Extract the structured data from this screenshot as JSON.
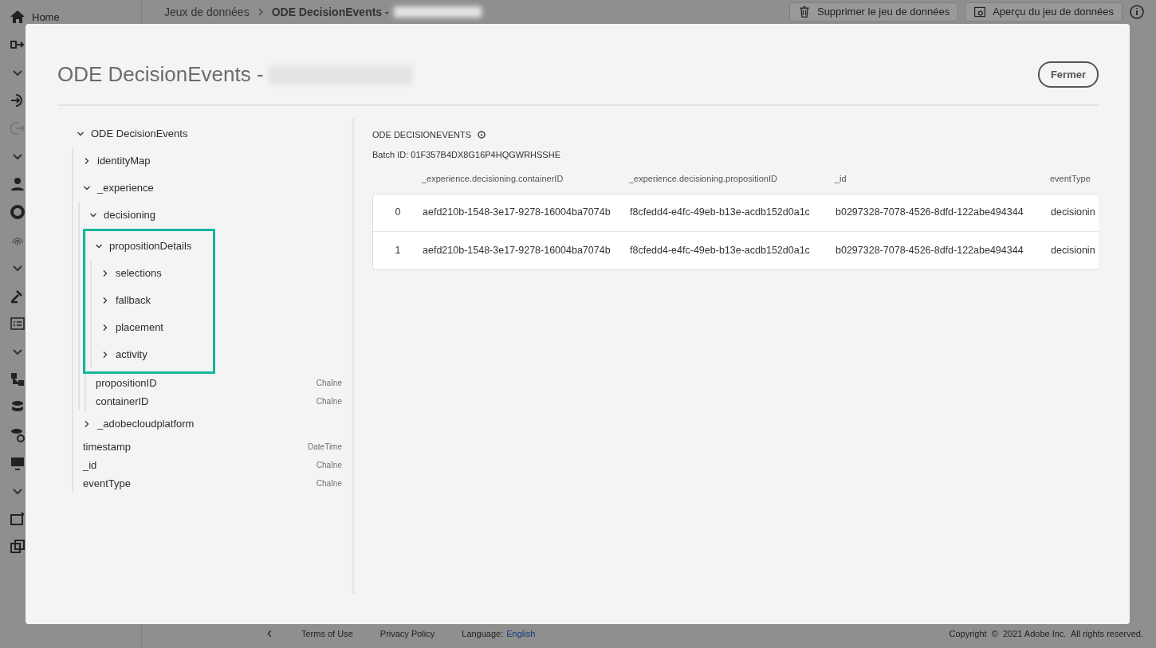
{
  "app": {
    "nav_home": "Home",
    "breadcrumb": [
      "Jeux de données",
      "ODE DecisionEvents -"
    ],
    "actions": [
      {
        "label": "Supprimer le jeu de données",
        "kind": "delete"
      },
      {
        "label": "Aperçu du jeu de données",
        "kind": "preview"
      }
    ]
  },
  "modal": {
    "title": "ODE DecisionEvents -",
    "close": "Fermer",
    "tree": [
      {
        "label": "ODE DecisionEvents",
        "expanded": true,
        "highlighted": false,
        "children": [
          {
            "label": "identityMap",
            "expanded": false,
            "highlighted": false
          },
          {
            "label": "_experience",
            "expanded": true,
            "highlighted": false,
            "children": [
              {
                "label": "decisioning",
                "expanded": true,
                "highlighted": false,
                "children": [
                  {
                    "label": "propositionDetails",
                    "expanded": true,
                    "highlighted": true,
                    "children": [
                      {
                        "label": "selections",
                        "expanded": false,
                        "highlighted": false
                      },
                      {
                        "label": "fallback",
                        "expanded": false,
                        "highlighted": false
                      },
                      {
                        "label": "placement",
                        "expanded": false,
                        "highlighted": false
                      },
                      {
                        "label": "activity",
                        "expanded": false,
                        "highlighted": false
                      }
                    ]
                  },
                  {
                    "label": "propositionID",
                    "type": "Chaîne"
                  },
                  {
                    "label": "containerID",
                    "type": "Chaîne"
                  }
                ]
              }
            ]
          },
          {
            "label": "_adobecloudplatform",
            "expanded": false,
            "highlighted": false
          },
          {
            "label": "timestamp",
            "type": "DateTime"
          },
          {
            "label": "_id",
            "type": "Chaîne"
          },
          {
            "label": "eventType",
            "type": "Chaîne"
          }
        ]
      }
    ],
    "preview": {
      "heading": "ODE DECISIONEVENTS",
      "batch": "Batch ID: 01F357B4DX8G16P4HQGWRHSSHE",
      "columns": [
        "_experience.decisioning.containerID",
        "_experience.decisioning.propositionID",
        "_id",
        "eventType"
      ],
      "rows": [
        {
          "index": "0",
          "cells": [
            "aefd210b-1548-3e17-9278-16004ba7074b",
            "f8cfedd4-e4fc-49eb-b13e-acdb152d0a1c",
            "b0297328-7078-4526-8dfd-122abe494344",
            "decisionin"
          ]
        },
        {
          "index": "1",
          "cells": [
            "aefd210b-1548-3e17-9278-16004ba7074b",
            "f8cfedd4-e4fc-49eb-b13e-acdb152d0a1c",
            "b0297328-7078-4526-8dfd-122abe494344",
            "decisionin"
          ]
        }
      ]
    }
  },
  "footer": {
    "links": [
      "Terms of Use",
      "Privacy Policy"
    ],
    "language_label": "Language:",
    "language": "English",
    "copyright": "Copyright  ©  2021 Adobe Inc.  All rights reserved."
  }
}
